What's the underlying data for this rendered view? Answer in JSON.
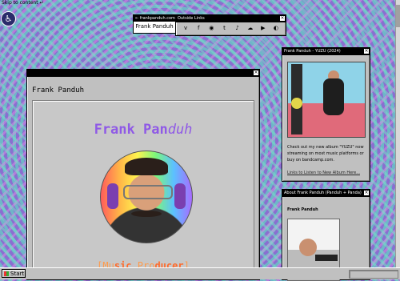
{
  "skip_link": "Skip to content",
  "accessibility_icon": "accessibility-icon",
  "nav": {
    "back": "← frankpanduh.com",
    "name": "Frank Panduh"
  },
  "outside_links": {
    "title": "Outside Links",
    "icons": [
      "vimeo-icon",
      "facebook-icon",
      "spotify-icon",
      "twitter-icon",
      "itunes-icon",
      "soundcloud-icon",
      "youtube-icon",
      "bandcamp-icon"
    ]
  },
  "main": {
    "title": "",
    "header": "Frank Panduh",
    "big_name_a": "Frank Pan",
    "big_name_b": "duh",
    "role_open": "[Mu",
    "role_a": "sic",
    "role_mid": " Pro",
    "role_b": "ducer",
    "role_close": "]"
  },
  "album": {
    "title": "Frank Panduh - YUZU (2024)",
    "text": "Check out my new album \"YUZU\" now streaming on most music platforms or buy on bandcamp.com.",
    "link": "Links to Listen to New Album Here..."
  },
  "about": {
    "title": "About Frank Panduh (Panduh + Panda)",
    "label": "Frank Panduh"
  },
  "taskbar": {
    "start": "Start"
  }
}
